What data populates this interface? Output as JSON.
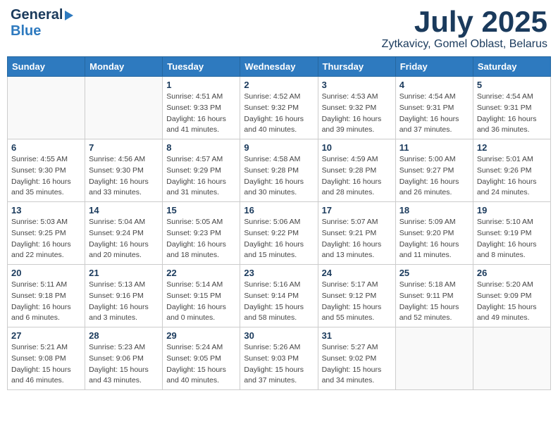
{
  "header": {
    "logo_general": "General",
    "logo_blue": "Blue",
    "month_year": "July 2025",
    "location": "Zytkavicy, Gomel Oblast, Belarus"
  },
  "days_of_week": [
    "Sunday",
    "Monday",
    "Tuesday",
    "Wednesday",
    "Thursday",
    "Friday",
    "Saturday"
  ],
  "weeks": [
    [
      {
        "day": "",
        "info": ""
      },
      {
        "day": "",
        "info": ""
      },
      {
        "day": "1",
        "info": "Sunrise: 4:51 AM\nSunset: 9:33 PM\nDaylight: 16 hours\nand 41 minutes."
      },
      {
        "day": "2",
        "info": "Sunrise: 4:52 AM\nSunset: 9:32 PM\nDaylight: 16 hours\nand 40 minutes."
      },
      {
        "day": "3",
        "info": "Sunrise: 4:53 AM\nSunset: 9:32 PM\nDaylight: 16 hours\nand 39 minutes."
      },
      {
        "day": "4",
        "info": "Sunrise: 4:54 AM\nSunset: 9:31 PM\nDaylight: 16 hours\nand 37 minutes."
      },
      {
        "day": "5",
        "info": "Sunrise: 4:54 AM\nSunset: 9:31 PM\nDaylight: 16 hours\nand 36 minutes."
      }
    ],
    [
      {
        "day": "6",
        "info": "Sunrise: 4:55 AM\nSunset: 9:30 PM\nDaylight: 16 hours\nand 35 minutes."
      },
      {
        "day": "7",
        "info": "Sunrise: 4:56 AM\nSunset: 9:30 PM\nDaylight: 16 hours\nand 33 minutes."
      },
      {
        "day": "8",
        "info": "Sunrise: 4:57 AM\nSunset: 9:29 PM\nDaylight: 16 hours\nand 31 minutes."
      },
      {
        "day": "9",
        "info": "Sunrise: 4:58 AM\nSunset: 9:28 PM\nDaylight: 16 hours\nand 30 minutes."
      },
      {
        "day": "10",
        "info": "Sunrise: 4:59 AM\nSunset: 9:28 PM\nDaylight: 16 hours\nand 28 minutes."
      },
      {
        "day": "11",
        "info": "Sunrise: 5:00 AM\nSunset: 9:27 PM\nDaylight: 16 hours\nand 26 minutes."
      },
      {
        "day": "12",
        "info": "Sunrise: 5:01 AM\nSunset: 9:26 PM\nDaylight: 16 hours\nand 24 minutes."
      }
    ],
    [
      {
        "day": "13",
        "info": "Sunrise: 5:03 AM\nSunset: 9:25 PM\nDaylight: 16 hours\nand 22 minutes."
      },
      {
        "day": "14",
        "info": "Sunrise: 5:04 AM\nSunset: 9:24 PM\nDaylight: 16 hours\nand 20 minutes."
      },
      {
        "day": "15",
        "info": "Sunrise: 5:05 AM\nSunset: 9:23 PM\nDaylight: 16 hours\nand 18 minutes."
      },
      {
        "day": "16",
        "info": "Sunrise: 5:06 AM\nSunset: 9:22 PM\nDaylight: 16 hours\nand 15 minutes."
      },
      {
        "day": "17",
        "info": "Sunrise: 5:07 AM\nSunset: 9:21 PM\nDaylight: 16 hours\nand 13 minutes."
      },
      {
        "day": "18",
        "info": "Sunrise: 5:09 AM\nSunset: 9:20 PM\nDaylight: 16 hours\nand 11 minutes."
      },
      {
        "day": "19",
        "info": "Sunrise: 5:10 AM\nSunset: 9:19 PM\nDaylight: 16 hours\nand 8 minutes."
      }
    ],
    [
      {
        "day": "20",
        "info": "Sunrise: 5:11 AM\nSunset: 9:18 PM\nDaylight: 16 hours\nand 6 minutes."
      },
      {
        "day": "21",
        "info": "Sunrise: 5:13 AM\nSunset: 9:16 PM\nDaylight: 16 hours\nand 3 minutes."
      },
      {
        "day": "22",
        "info": "Sunrise: 5:14 AM\nSunset: 9:15 PM\nDaylight: 16 hours\nand 0 minutes."
      },
      {
        "day": "23",
        "info": "Sunrise: 5:16 AM\nSunset: 9:14 PM\nDaylight: 15 hours\nand 58 minutes."
      },
      {
        "day": "24",
        "info": "Sunrise: 5:17 AM\nSunset: 9:12 PM\nDaylight: 15 hours\nand 55 minutes."
      },
      {
        "day": "25",
        "info": "Sunrise: 5:18 AM\nSunset: 9:11 PM\nDaylight: 15 hours\nand 52 minutes."
      },
      {
        "day": "26",
        "info": "Sunrise: 5:20 AM\nSunset: 9:09 PM\nDaylight: 15 hours\nand 49 minutes."
      }
    ],
    [
      {
        "day": "27",
        "info": "Sunrise: 5:21 AM\nSunset: 9:08 PM\nDaylight: 15 hours\nand 46 minutes."
      },
      {
        "day": "28",
        "info": "Sunrise: 5:23 AM\nSunset: 9:06 PM\nDaylight: 15 hours\nand 43 minutes."
      },
      {
        "day": "29",
        "info": "Sunrise: 5:24 AM\nSunset: 9:05 PM\nDaylight: 15 hours\nand 40 minutes."
      },
      {
        "day": "30",
        "info": "Sunrise: 5:26 AM\nSunset: 9:03 PM\nDaylight: 15 hours\nand 37 minutes."
      },
      {
        "day": "31",
        "info": "Sunrise: 5:27 AM\nSunset: 9:02 PM\nDaylight: 15 hours\nand 34 minutes."
      },
      {
        "day": "",
        "info": ""
      },
      {
        "day": "",
        "info": ""
      }
    ]
  ]
}
